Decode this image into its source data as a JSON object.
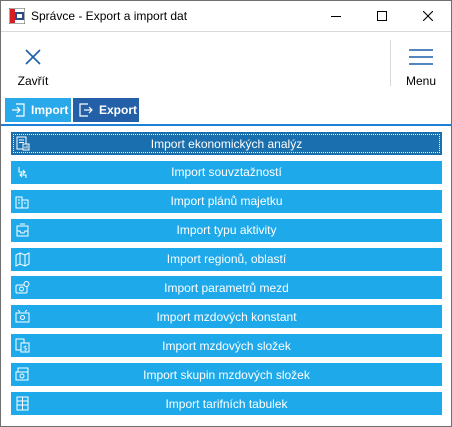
{
  "window": {
    "title": "Správce - Export a import dat",
    "icon": "app-logo-icon"
  },
  "title_buttons": {
    "minimize": "minimize-icon",
    "maximize": "maximize-icon",
    "close": "close-icon"
  },
  "toolbar": {
    "close_label": "Zavřít",
    "menu_label": "Menu"
  },
  "tabs": [
    {
      "label": "Import",
      "icon": "import-icon",
      "active": true
    },
    {
      "label": "Export",
      "icon": "export-icon",
      "active": false
    }
  ],
  "items": [
    {
      "label": "Import ekonomických analýz",
      "icon": "document-chart-icon",
      "selected": true
    },
    {
      "label": "Import souvztažností",
      "icon": "arrows-icon",
      "selected": false
    },
    {
      "label": "Import plánů majetku",
      "icon": "buildings-icon",
      "selected": false
    },
    {
      "label": "Import typu aktivity",
      "icon": "tray-icon",
      "selected": false
    },
    {
      "label": "Import regionů, oblastí",
      "icon": "map-icon",
      "selected": false
    },
    {
      "label": "Import parametrů mezd",
      "icon": "wage-parameters-icon",
      "selected": false
    },
    {
      "label": "Import mzdových konstant",
      "icon": "wage-constants-icon",
      "selected": false
    },
    {
      "label": "Import mzdových složek",
      "icon": "wage-components-icon",
      "selected": false
    },
    {
      "label": "Import skupin mzdových složek",
      "icon": "wage-groups-icon",
      "selected": false
    },
    {
      "label": "Import tarifních tabulek",
      "icon": "table-icon",
      "selected": false
    }
  ],
  "colors": {
    "item_bg": "#1ea9ea",
    "item_selected_bg": "#1a6fae",
    "tab_active": "#29a8ea",
    "tab_inactive": "#2360a8",
    "accent_line": "#1e7fd6"
  }
}
